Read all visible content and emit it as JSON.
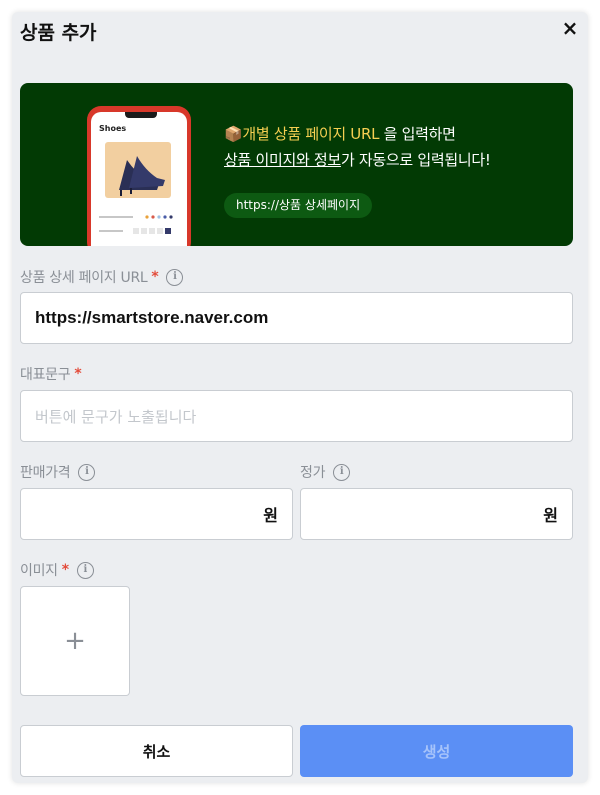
{
  "modal": {
    "title": "상품 추가",
    "close_label": "×"
  },
  "banner": {
    "icon": "package-icon",
    "line1_highlight": "개별 상품 페이지 URL",
    "line1_rest": " 을 입력하면",
    "line2_underlined": "상품 이미지와 정보",
    "line2_rest": "가 자동으로 입력됩니다!",
    "pill": "https://상품 상세페이지",
    "phone_title": "Shoes",
    "colors": {
      "bg": "#023a04",
      "highlight": "#f5cf52"
    }
  },
  "fields": {
    "url": {
      "label": "상품 상세 페이지 URL",
      "required": "*",
      "value": "https://smartstore.naver.com"
    },
    "headline": {
      "label": "대표문구",
      "required": "*",
      "placeholder": "버튼에 문구가 노출됩니다"
    },
    "sale_price": {
      "label": "판매가격",
      "unit": "원"
    },
    "list_price": {
      "label": "정가",
      "unit": "원"
    },
    "image": {
      "label": "이미지",
      "required": "*",
      "add_label": "+"
    }
  },
  "buttons": {
    "cancel": "취소",
    "create": "생성"
  },
  "colors": {
    "primary": "#5b8ff5",
    "required": "#e34b3a"
  }
}
